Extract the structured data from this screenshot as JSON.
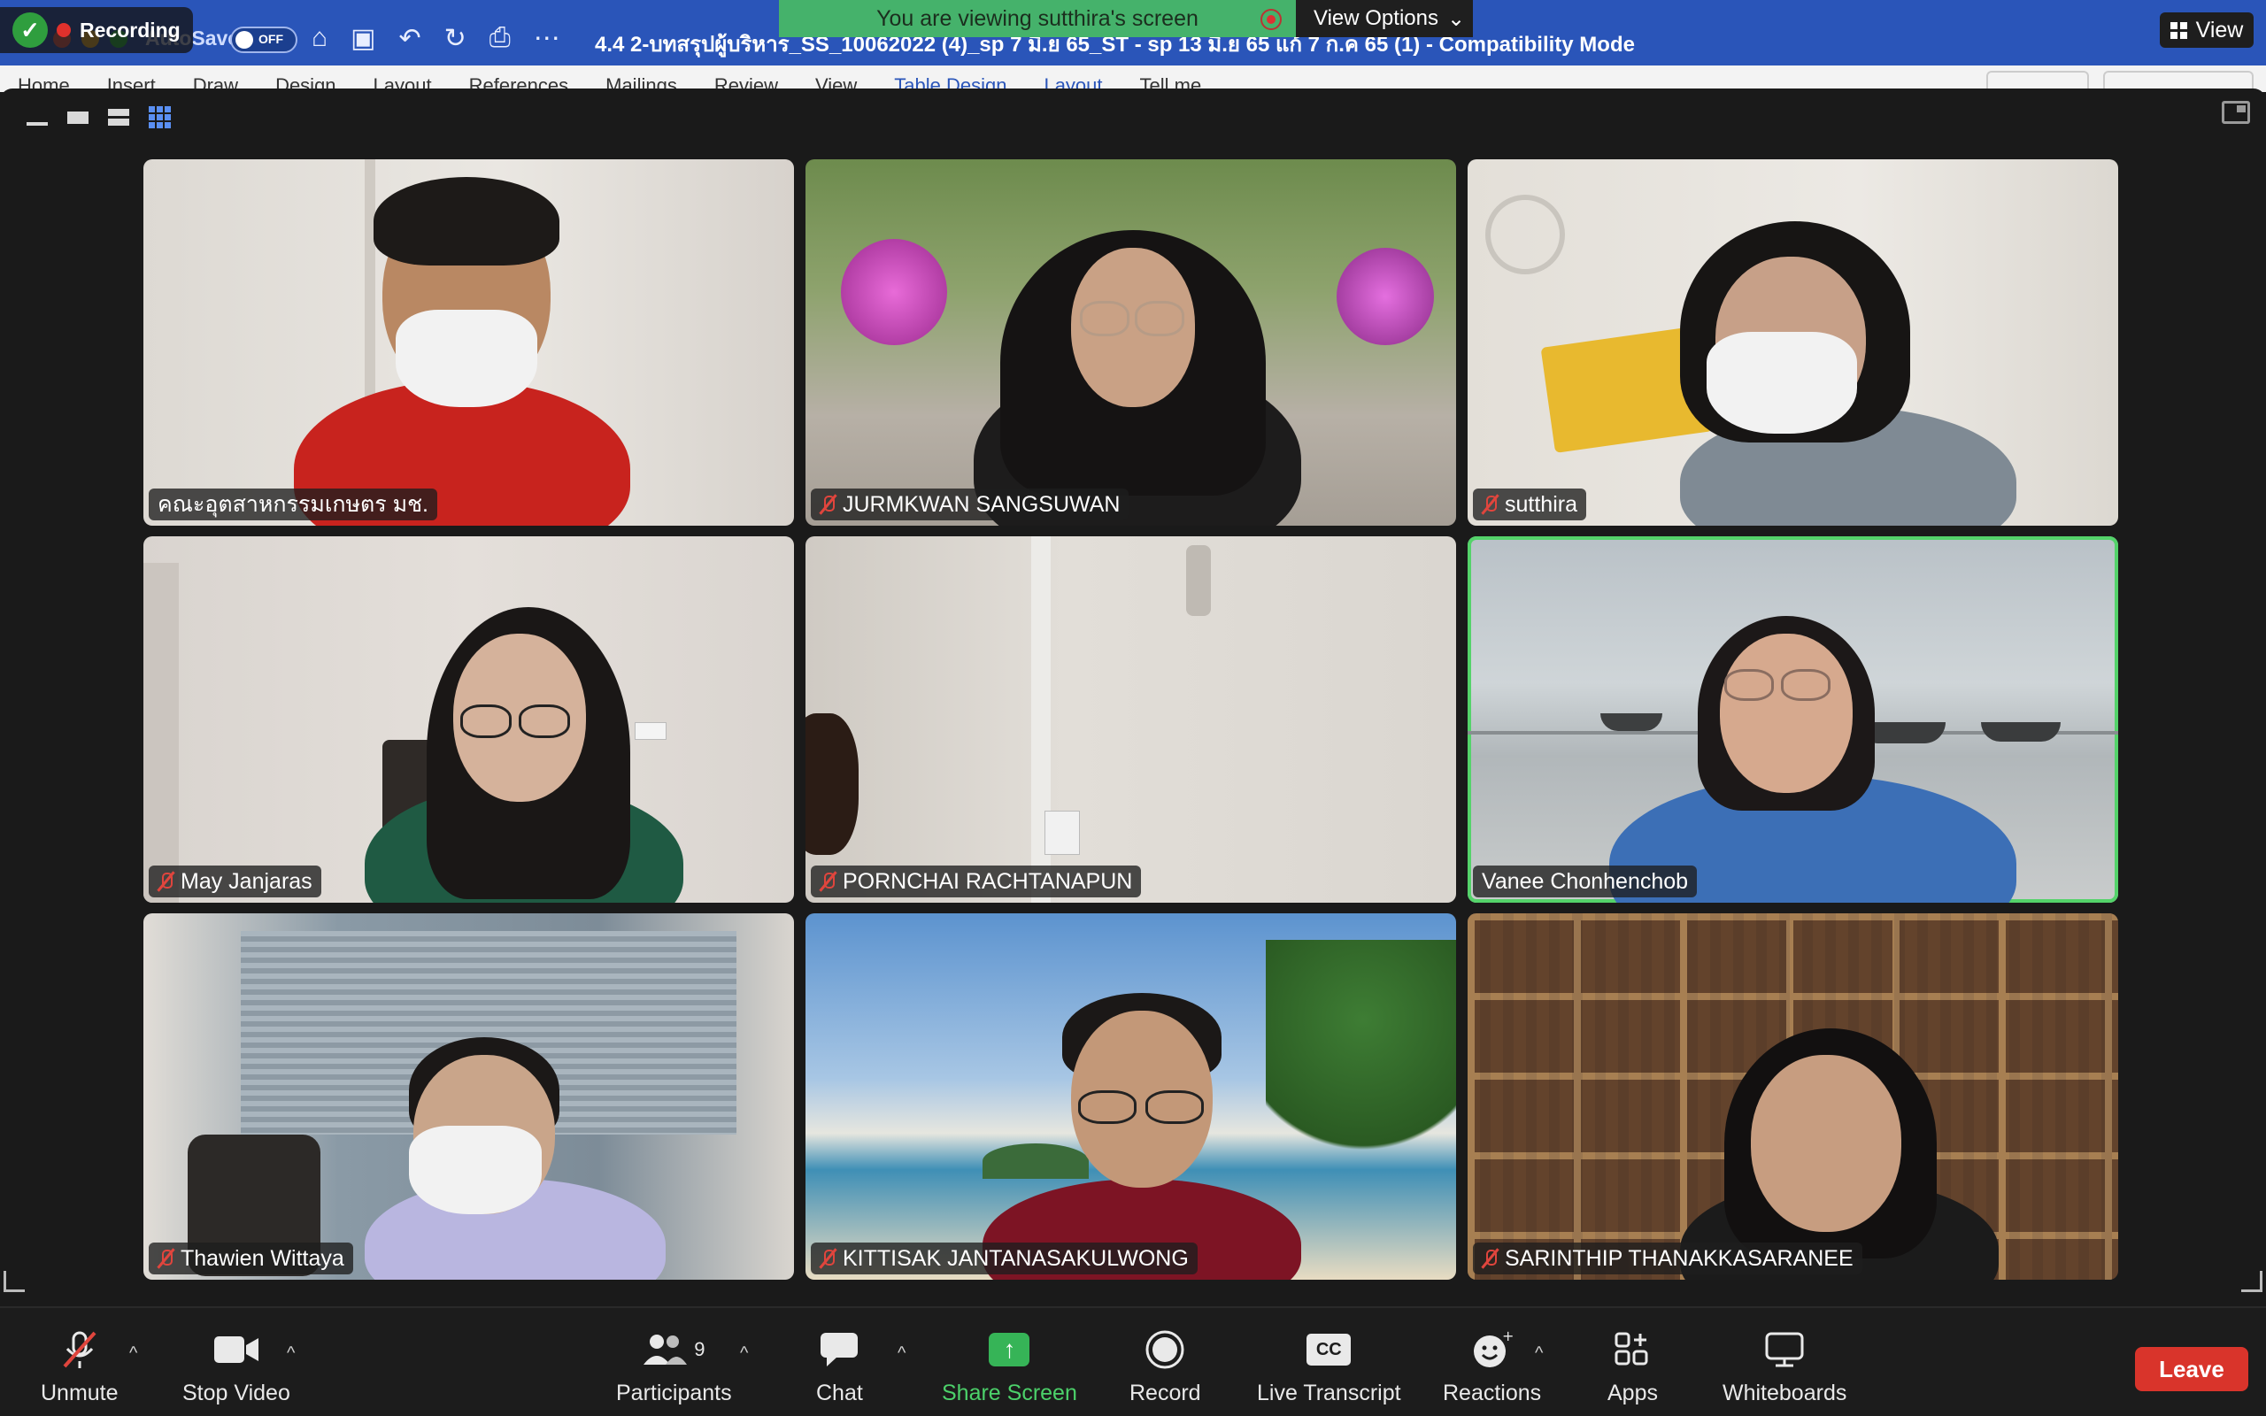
{
  "word": {
    "autosave_label": "AutoSave",
    "autosave_state": "OFF",
    "doc_title": "4.4 2-บทสรุปผู้บริหาร_SS_10062022 (4)_sp 7 มิ.ย 65_ST - sp 13 มิ.ย 65 แก้ 7 ก.ค 65 (1)  -  Compatibility Mode",
    "ribbon_tabs": [
      "Home",
      "Insert",
      "Draw",
      "Design",
      "Layout",
      "References",
      "Mailings",
      "Review",
      "View",
      "Table Design",
      "Layout",
      "Tell me"
    ]
  },
  "recording": {
    "label": "Recording"
  },
  "share_banner": {
    "text": "You are viewing sutthira's screen",
    "view_options": "View Options"
  },
  "view_button": {
    "label": "View"
  },
  "participants": [
    {
      "name": "คณะอุตสาหกรรมเกษตร มช.",
      "muted": false,
      "speaking": false
    },
    {
      "name": "JURMKWAN SANGSUWAN",
      "muted": true,
      "speaking": false
    },
    {
      "name": "sutthira",
      "muted": true,
      "speaking": false
    },
    {
      "name": "May Janjaras",
      "muted": true,
      "speaking": false
    },
    {
      "name": "PORNCHAI RACHTANAPUN",
      "muted": true,
      "speaking": false
    },
    {
      "name": "Vanee Chonhenchob",
      "muted": false,
      "speaking": true
    },
    {
      "name": "Thawien Wittaya",
      "muted": true,
      "speaking": false
    },
    {
      "name": "KITTISAK JANTANASAKULWONG",
      "muted": true,
      "speaking": false
    },
    {
      "name": "SARINTHIP THANAKKASARANEE",
      "muted": true,
      "speaking": false
    }
  ],
  "toolbar": {
    "unmute": "Unmute",
    "stop_video": "Stop Video",
    "participants": "Participants",
    "participants_count": "9",
    "chat": "Chat",
    "share_screen": "Share Screen",
    "record": "Record",
    "live_transcript": "Live Transcript",
    "cc_badge": "CC",
    "reactions": "Reactions",
    "apps": "Apps",
    "whiteboards": "Whiteboards",
    "leave": "Leave"
  },
  "colors": {
    "share_green": "#45b26b",
    "active_speaker": "#54d36a",
    "leave_red": "#d9342b",
    "word_blue": "#2a55b9"
  }
}
